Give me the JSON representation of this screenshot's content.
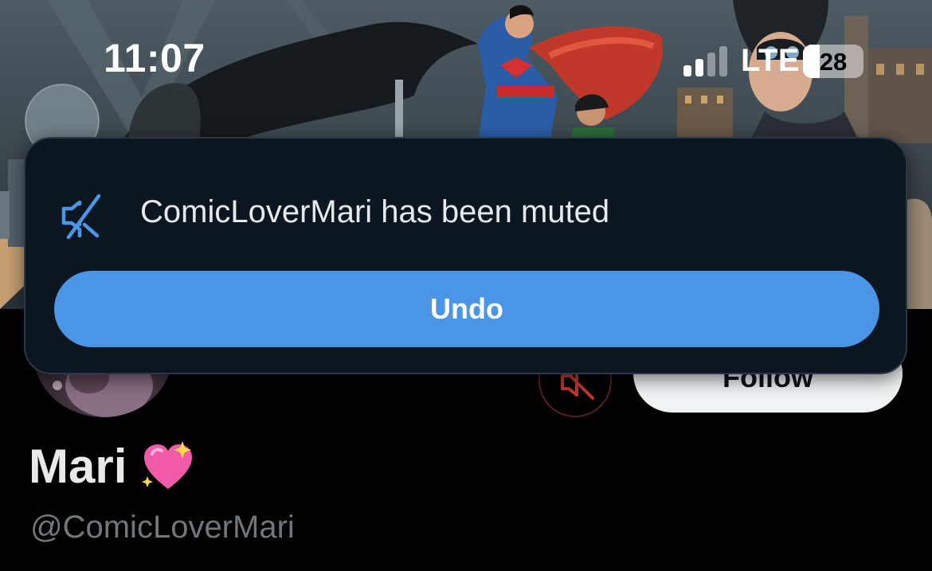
{
  "status_bar": {
    "time": "11:07",
    "network": "LTE",
    "battery_level": "28",
    "battery_fraction": 0.28,
    "signal_bars_active": 2,
    "signal_bars_total": 4
  },
  "toast": {
    "icon": "mute-speaker-icon",
    "message": "ComicLoverMari has been muted",
    "undo_label": "Undo"
  },
  "profile": {
    "display_name": "Mari",
    "name_emoji": "sparkling-heart",
    "handle": "@ComicLoverMari",
    "follow_label": "Follow",
    "mute_icon": "muted-speaker-icon"
  },
  "colors": {
    "accent_blue": "#4a95e6",
    "toast_bg": "#0c1620",
    "follow_bg": "#eff3f4",
    "muted_red": "#c0392b",
    "handle_gray": "#71767b"
  }
}
